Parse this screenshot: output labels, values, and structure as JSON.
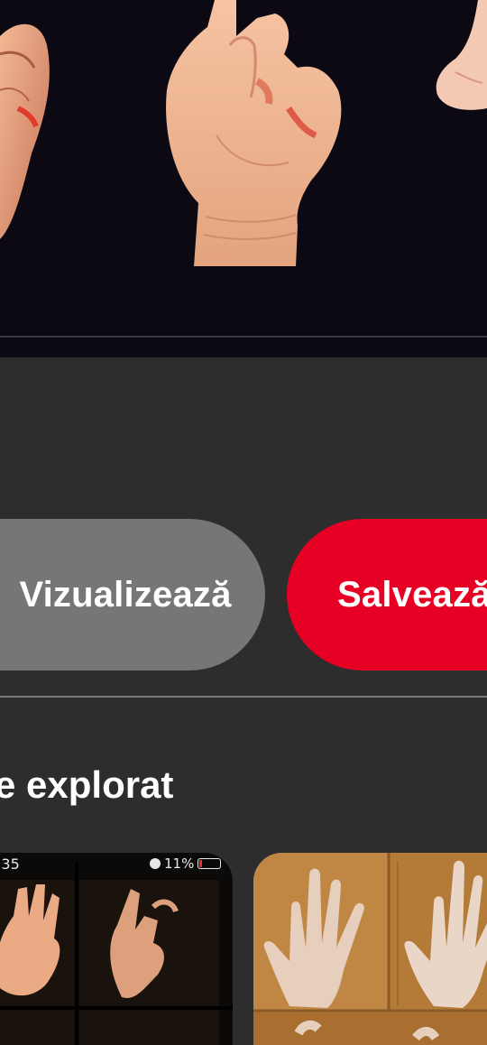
{
  "actions": {
    "visit_label": "Vizualizează",
    "save_label": "Salvează"
  },
  "explore": {
    "title": "e explorat"
  },
  "pins": [
    {
      "status_time": ":35",
      "status_battery": "11%"
    }
  ],
  "colors": {
    "background": "#2d2d2d",
    "save_button": "#e60023",
    "visit_button": "#767676",
    "text": "#ffffff"
  }
}
